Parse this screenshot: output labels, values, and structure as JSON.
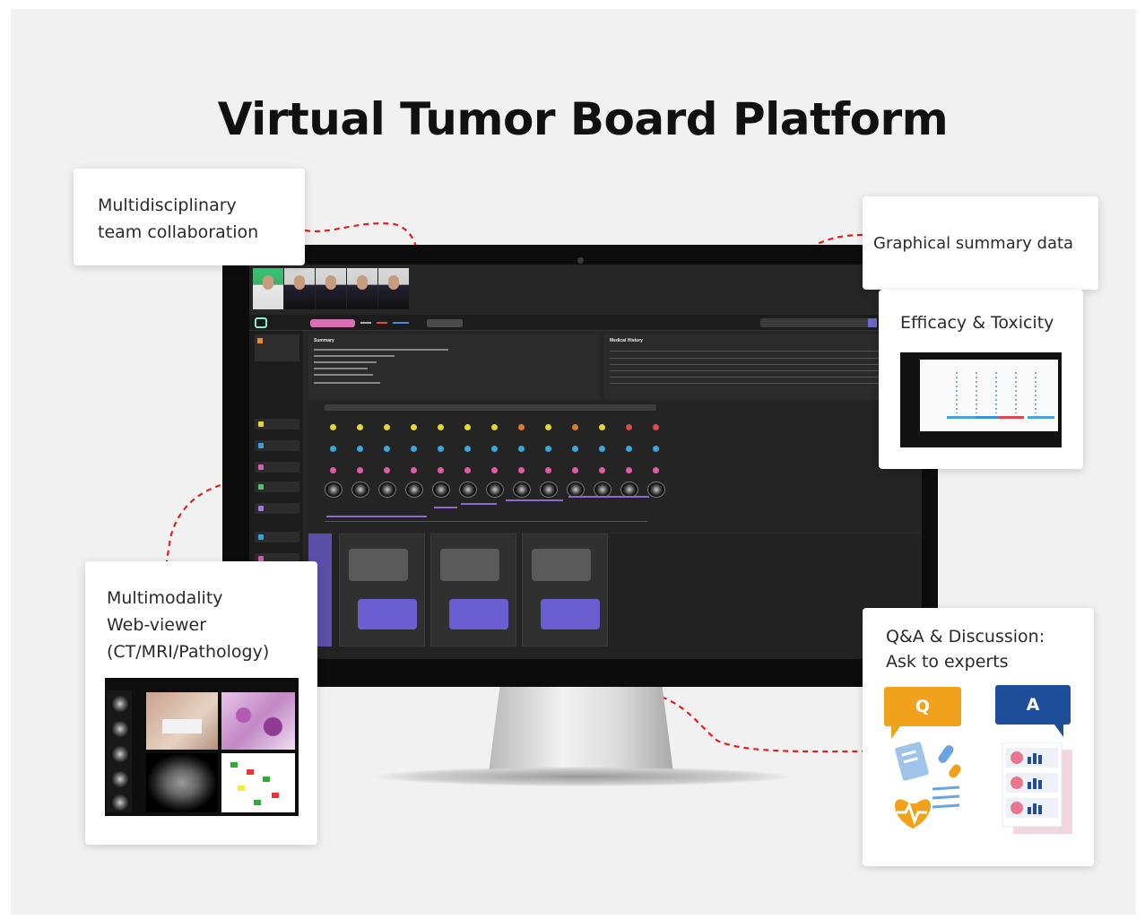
{
  "title": "Virtual Tumor Board Platform",
  "callouts": {
    "team": "Multidisciplinary\nteam collaboration",
    "graphical": "Graphical summary data",
    "efficacy": "Efficacy & Toxicity",
    "viewer": "Multimodality\nWeb-viewer\n(CT/MRI/Pathology)",
    "qa": "Q&A & Discussion:\nAsk to experts"
  },
  "qa_icons": {
    "q": "Q",
    "a": "A"
  },
  "screen": {
    "summary_title": "Summary",
    "medical_history_title": "Medical History"
  },
  "colors": {
    "accent_red": "#e02020",
    "qa_orange": "#f0a21d",
    "qa_blue": "#1e4e9a",
    "tag_pink": "#d86fb5",
    "chat_purple": "#6a5ed0"
  }
}
